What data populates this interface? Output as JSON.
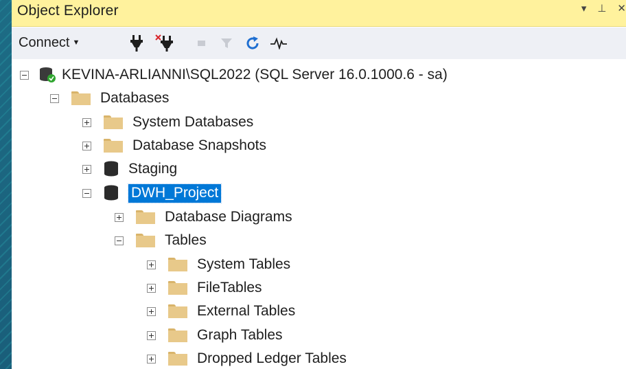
{
  "panel": {
    "title": "Object Explorer",
    "window_buttons": [
      "▾",
      "⊥",
      "✕"
    ]
  },
  "toolbar": {
    "connect_label": "Connect",
    "icons": [
      "connect-plug-icon",
      "disconnect-plug-icon",
      "stop-icon",
      "filter-icon",
      "refresh-icon",
      "activity-monitor-icon"
    ]
  },
  "tree": {
    "server": "KEVINA-ARLIANNI\\SQL2022 (SQL Server 16.0.1000.6 - sa)",
    "databases": "Databases",
    "system_databases": "System Databases",
    "database_snapshots": "Database Snapshots",
    "staging": "Staging",
    "dwh_project": "DWH_Project",
    "database_diagrams": "Database Diagrams",
    "tables": "Tables",
    "system_tables": "System Tables",
    "file_tables": "FileTables",
    "external_tables": "External Tables",
    "graph_tables": "Graph Tables",
    "dropped_ledger_tables": "Dropped Ledger Tables"
  },
  "colors": {
    "titlebar": "#fff29d",
    "toolbar": "#eef0f5",
    "selection": "#0078d7",
    "folder": "#e8c98a"
  }
}
